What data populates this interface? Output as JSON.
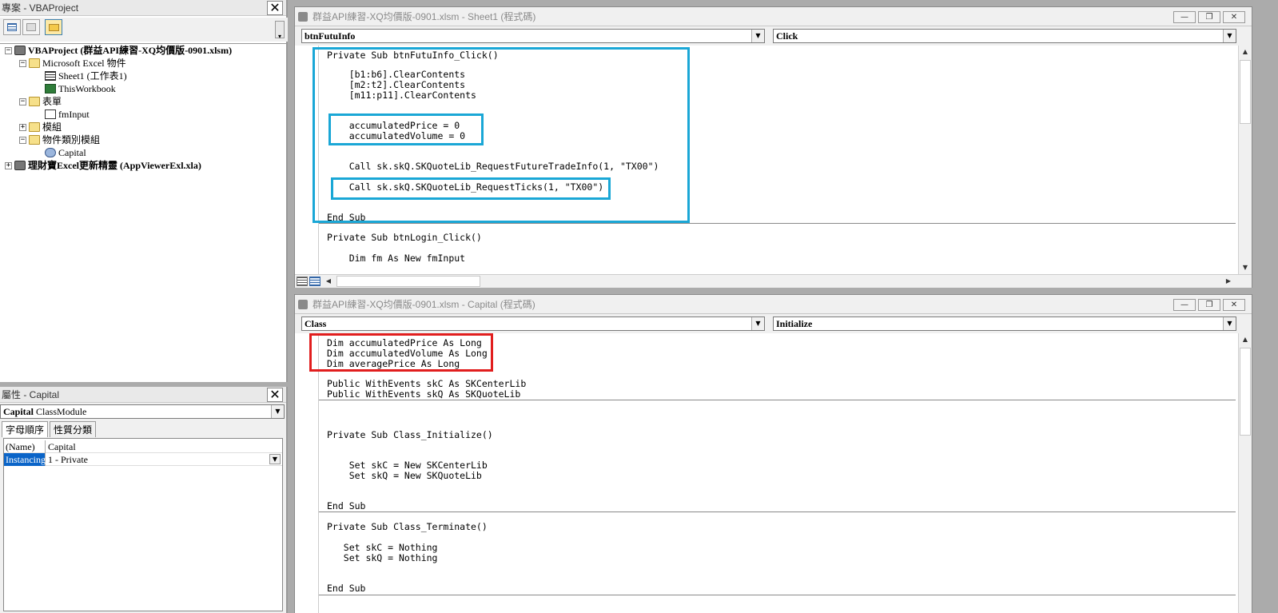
{
  "project_panel": {
    "title": "專案 - VBAProject",
    "tree": {
      "root1": "VBAProject (群益API練習-XQ均價版-0901.xlsm)",
      "excel_objects": "Microsoft Excel 物件",
      "sheet1": "Sheet1 (工作表1)",
      "thisworkbook": "ThisWorkbook",
      "forms": "表單",
      "fminput": "fmInput",
      "modules": "模組",
      "class_modules": "物件類別模組",
      "capital": "Capital",
      "root2": "理財寶Excel更新精靈 (AppViewerExl.xla)"
    }
  },
  "props_panel": {
    "title": "屬性 - Capital",
    "object_combo": {
      "name": "Capital",
      "type": "ClassModule"
    },
    "tabs": [
      "字母順序",
      "性質分類"
    ],
    "rows": [
      {
        "name": "(Name)",
        "value": "Capital"
      },
      {
        "name": "Instancing",
        "value": "1 - Private"
      }
    ]
  },
  "win1": {
    "title": "群益API練習-XQ均價版-0901.xlsm - Sheet1 (程式碼)",
    "object_combo": "btnFutuInfo",
    "proc_combo": "Click",
    "code": {
      "l1": "Private Sub btnFutuInfo_Click()",
      "l2": "    [b1:b6].ClearContents",
      "l3": "    [m2:t2].ClearContents",
      "l4": "    [m11:p11].ClearContents",
      "l5": "    accumulatedPrice = 0",
      "l6": "    accumulatedVolume = 0",
      "l7": "    Call sk.skQ.SKQuoteLib_RequestFutureTradeInfo(1, \"TX00\")",
      "l8": "    Call sk.skQ.SKQuoteLib_RequestTicks(1, \"TX00\")",
      "l9": "End Sub",
      "l10": "Private Sub btnLogin_Click()",
      "l11": "    Dim fm As New fmInput"
    }
  },
  "win2": {
    "title": "群益API練習-XQ均價版-0901.xlsm - Capital (程式碼)",
    "object_combo": "Class",
    "proc_combo": "Initialize",
    "code": {
      "l1": "Dim accumulatedPrice As Long",
      "l2": "Dim accumulatedVolume As Long",
      "l3": "Dim averagePrice As Long",
      "l4": "Public WithEvents skC As SKCenterLib",
      "l5": "Public WithEvents skQ As SKQuoteLib",
      "l6": "Private Sub Class_Initialize()",
      "l7": "    Set skC = New SKCenterLib",
      "l8": "    Set skQ = New SKQuoteLib",
      "l9": "End Sub",
      "l10": "Private Sub Class_Terminate()",
      "l11": "   Set skC = Nothing",
      "l12": "   Set skQ = Nothing",
      "l13": "End Sub"
    }
  },
  "colors": {
    "highlight_blue": "#1aa7d6",
    "highlight_red": "#e11e1e",
    "selection": "#0a64c8"
  }
}
